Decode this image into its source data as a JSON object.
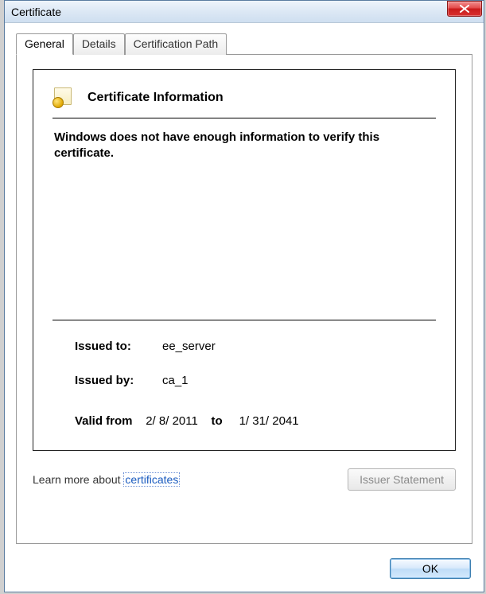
{
  "window": {
    "title": "Certificate"
  },
  "tabs": {
    "general": "General",
    "details": "Details",
    "certpath": "Certification Path"
  },
  "cert": {
    "heading": "Certificate Information",
    "status": "Windows does not have enough information to verify this certificate.",
    "issued_to_label": "Issued to:",
    "issued_to": "ee_server",
    "issued_by_label": "Issued by:",
    "issued_by": "ca_1",
    "valid_from_label": "Valid from",
    "valid_from": "2/ 8/ 2011",
    "valid_to_label": "to",
    "valid_to": "1/ 31/ 2041"
  },
  "buttons": {
    "issuer_statement": "Issuer Statement",
    "ok": "OK"
  },
  "learn": {
    "prefix": "Learn more about ",
    "link": "certificates"
  }
}
